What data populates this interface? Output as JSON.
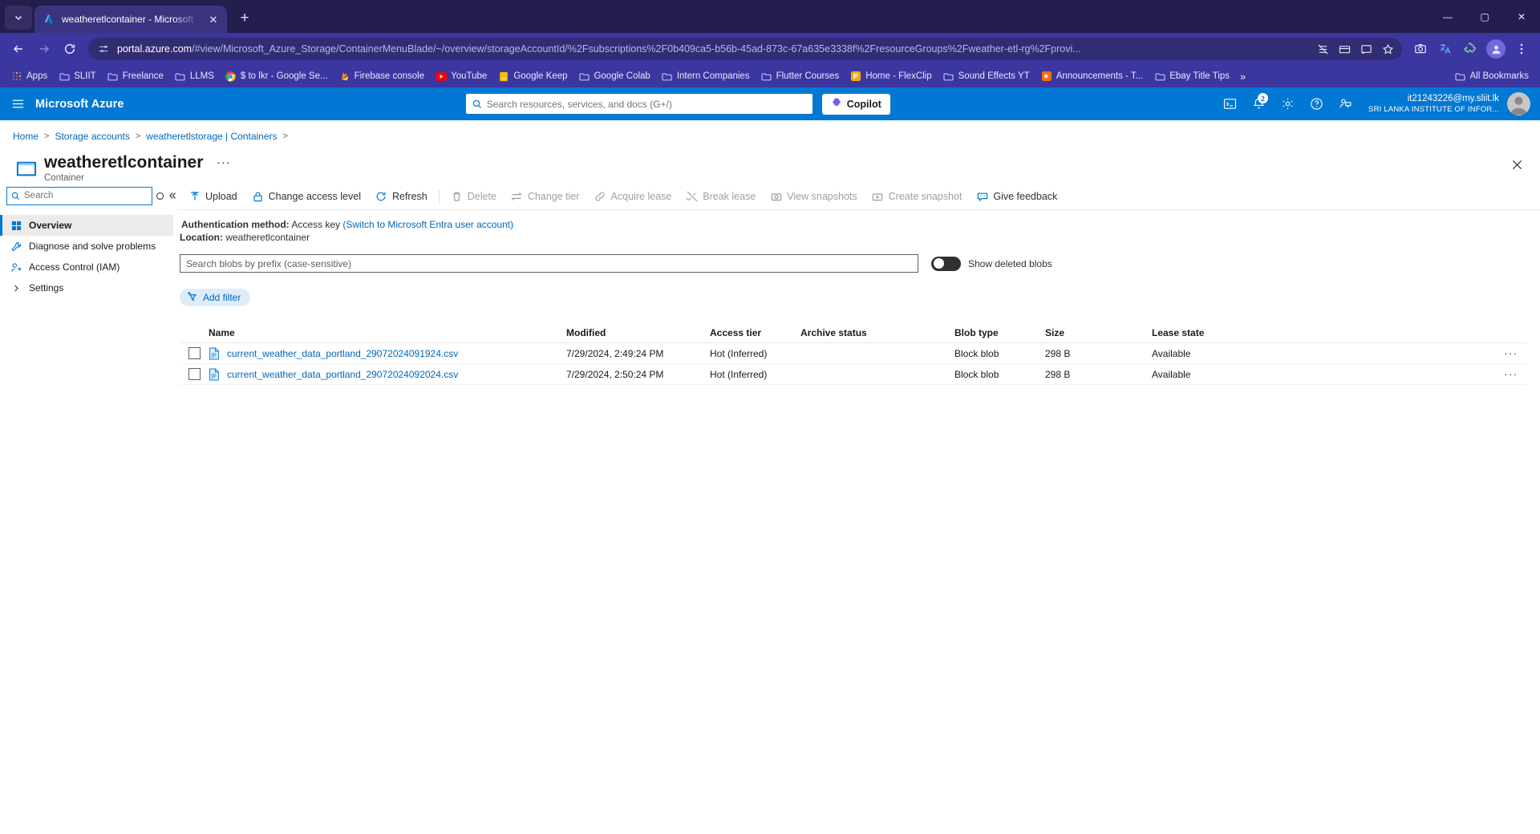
{
  "browser": {
    "tab": {
      "title": "weatheretlcontainer - Microsoft",
      "favicon_icon": "azure-logo-icon",
      "close_icon": "close-icon"
    },
    "new_tab_label": "+",
    "tab_list_chevron_icon": "chevron-down-icon",
    "window_controls": {
      "minimize": "minimize-icon",
      "maximize": "maximize-icon",
      "close": "close-icon"
    },
    "nav": {
      "back_icon": "back-arrow-icon",
      "forward_icon": "forward-arrow-icon",
      "reload_icon": "reload-icon",
      "site_settings_icon": "tune-icon",
      "url_domain": "portal.azure.com",
      "url_path": "/#view/Microsoft_Azure_Storage/ContainerMenuBlade/~/overview/storageAccountId/%2Fsubscriptions%2F0b409ca5-b56b-45ad-873c-67a635e3338f%2FresourceGroups%2Fweather-etl-rg%2Fprovi...",
      "tracking_icon": "tracking-protection-icon",
      "payment_icon": "card-icon",
      "cast_icon": "cast-icon",
      "bookmark_star_icon": "star-icon",
      "screenshot_icon": "capture-icon",
      "translate_icon": "translate-icon",
      "extensions_icon": "puzzle-icon",
      "profile_icon": "profile-avatar-icon",
      "menu_icon": "kebab-menu-icon"
    },
    "bookmarks": [
      {
        "label": "Apps",
        "icon": "apps-grid-icon"
      },
      {
        "label": "SLIIT",
        "icon": "folder-icon"
      },
      {
        "label": "Freelance",
        "icon": "folder-icon"
      },
      {
        "label": "LLMS",
        "icon": "folder-icon"
      },
      {
        "label": "$ to lkr - Google Se...",
        "icon": "chrome-icon"
      },
      {
        "label": "Firebase console",
        "icon": "firebase-icon"
      },
      {
        "label": "YouTube",
        "icon": "youtube-icon"
      },
      {
        "label": "Google Keep",
        "icon": "keep-icon"
      },
      {
        "label": "Google Colab",
        "icon": "folder-icon"
      },
      {
        "label": "Intern Companies",
        "icon": "folder-icon"
      },
      {
        "label": "Flutter Courses",
        "icon": "folder-icon"
      },
      {
        "label": "Home - FlexClip",
        "icon": "flexclip-icon"
      },
      {
        "label": "Sound Effects YT",
        "icon": "folder-icon"
      },
      {
        "label": "Announcements - T...",
        "icon": "announce-icon"
      },
      {
        "label": "Ebay Title Tips",
        "icon": "folder-icon"
      }
    ],
    "bookmarks_overflow_icon": "chevron-double-right-icon",
    "all_bookmarks_label": "All Bookmarks",
    "all_bookmarks_icon": "folder-icon"
  },
  "azure_header": {
    "hamburger_icon": "hamburger-menu-icon",
    "brand": "Microsoft Azure",
    "search": {
      "placeholder": "Search resources, services, and docs (G+/)",
      "icon": "search-icon",
      "value": ""
    },
    "copilot": {
      "label": "Copilot",
      "icon": "copilot-icon"
    },
    "icons": [
      {
        "name": "cloud-shell-icon",
        "badge": ""
      },
      {
        "name": "notifications-bell-icon",
        "badge": "2"
      },
      {
        "name": "settings-gear-icon",
        "badge": ""
      },
      {
        "name": "help-question-icon",
        "badge": ""
      },
      {
        "name": "feedback-person-icon",
        "badge": ""
      }
    ],
    "account": {
      "email": "it21243226@my.sliit.lk",
      "org": "SRI LANKA INSTITUTE OF INFOR...",
      "avatar_icon": "user-avatar-icon"
    },
    "accent_color": "#0078d4"
  },
  "breadcrumb": {
    "items": [
      "Home",
      "Storage accounts",
      "weatheretlstorage | Containers"
    ],
    "separator": ">"
  },
  "blade": {
    "icon": "container-icon",
    "title": "weatheretlcontainer",
    "ellipsis": "···",
    "subtitle": "Container",
    "close_icon": "close-icon"
  },
  "leftnav": {
    "search": {
      "placeholder": "Search",
      "value": "",
      "icon": "search-icon"
    },
    "refresh_icon": "circle-icon",
    "collapse_icon": "double-chevron-left-icon",
    "items": [
      {
        "label": "Overview",
        "icon": "overview-icon",
        "active": true
      },
      {
        "label": "Diagnose and solve problems",
        "icon": "wrench-icon",
        "active": false
      },
      {
        "label": "Access Control (IAM)",
        "icon": "key-person-icon",
        "active": false
      },
      {
        "label": "Settings",
        "icon": "chevron-right-icon",
        "active": false
      }
    ]
  },
  "commandbar": [
    {
      "label": "Upload",
      "icon": "upload-arrow-icon",
      "disabled": false
    },
    {
      "label": "Change access level",
      "icon": "lock-icon",
      "disabled": false
    },
    {
      "label": "Refresh",
      "icon": "refresh-circle-icon",
      "disabled": false
    },
    {
      "label": "Delete",
      "icon": "trash-icon",
      "disabled": true
    },
    {
      "label": "Change tier",
      "icon": "swap-arrows-icon",
      "disabled": true
    },
    {
      "label": "Acquire lease",
      "icon": "link-icon",
      "disabled": true
    },
    {
      "label": "Break lease",
      "icon": "broken-link-icon",
      "disabled": true
    },
    {
      "label": "View snapshots",
      "icon": "camera-icon",
      "disabled": true
    },
    {
      "label": "Create snapshot",
      "icon": "camera-plus-icon",
      "disabled": true
    },
    {
      "label": "Give feedback",
      "icon": "smiley-feedback-icon",
      "disabled": false
    }
  ],
  "info": {
    "auth_label": "Authentication method:",
    "auth_value": "Access key",
    "auth_link": "(Switch to Microsoft Entra user account)",
    "location_label": "Location:",
    "location_value": "weatheretlcontainer"
  },
  "filters": {
    "prefix_search": {
      "placeholder": "Search blobs by prefix (case-sensitive)",
      "value": ""
    },
    "show_deleted": {
      "label": "Show deleted blobs",
      "enabled": false
    },
    "add_filter": {
      "label": "Add filter",
      "icon": "add-filter-icon"
    }
  },
  "table": {
    "columns": [
      "Name",
      "Modified",
      "Access tier",
      "Archive status",
      "Blob type",
      "Size",
      "Lease state"
    ],
    "rows": [
      {
        "name": "current_weather_data_portland_29072024091924.csv",
        "modified": "7/29/2024, 2:49:24 PM",
        "access_tier": "Hot (Inferred)",
        "archive_status": "",
        "blob_type": "Block blob",
        "size": "298 B",
        "lease_state": "Available",
        "file_icon": "csv-file-icon",
        "menu_icon": "more-actions-icon",
        "checkbox_icon": "checkbox-icon"
      },
      {
        "name": "current_weather_data_portland_29072024092024.csv",
        "modified": "7/29/2024, 2:50:24 PM",
        "access_tier": "Hot (Inferred)",
        "archive_status": "",
        "blob_type": "Block blob",
        "size": "298 B",
        "lease_state": "Available",
        "file_icon": "csv-file-icon",
        "menu_icon": "more-actions-icon",
        "checkbox_icon": "checkbox-icon"
      }
    ]
  }
}
